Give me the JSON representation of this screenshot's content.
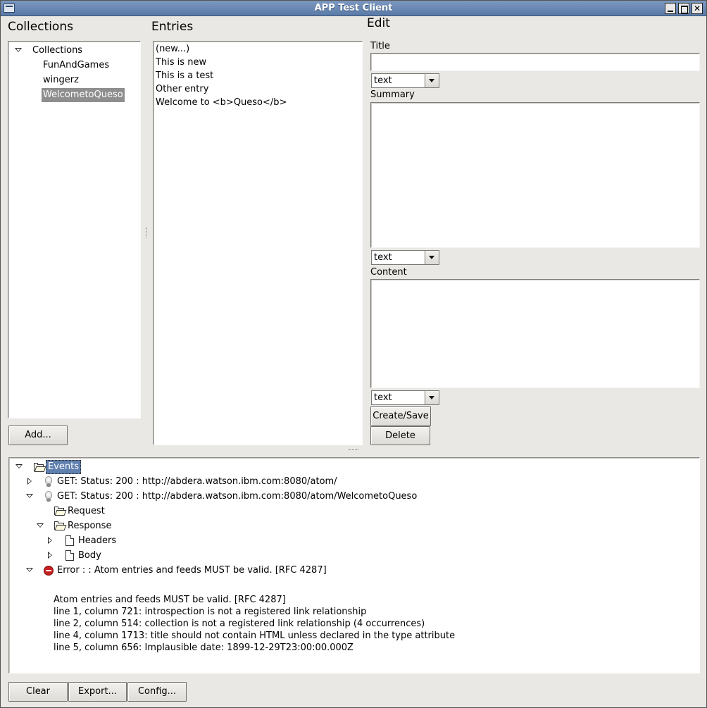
{
  "window": {
    "title": "APP Test Client"
  },
  "collections": {
    "header": "Collections",
    "root_label": "Collections",
    "items": [
      "FunAndGames",
      "wingerz",
      "WelcometoQueso"
    ],
    "add_button": "Add..."
  },
  "entries": {
    "header": "Entries",
    "items": [
      "(new...)",
      "This is new",
      "This is a test",
      "Other entry",
      "Welcome to <b>Queso</b>"
    ]
  },
  "edit": {
    "header": "Edit",
    "title_label": "Title",
    "title_value": "",
    "title_type": "text",
    "summary_label": "Summary",
    "summary_value": "",
    "summary_type": "text",
    "content_label": "Content",
    "content_value": "",
    "content_type": "text",
    "create_save_button": "Create/Save",
    "delete_button": "Delete"
  },
  "events": {
    "root_label": "Events",
    "rows": [
      "GET: Status: 200 : http://abdera.watson.ibm.com:8080/atom/",
      "GET: Status: 200 : http://abdera.watson.ibm.com:8080/atom/WelcometoQueso",
      "Request",
      "Response",
      "Headers",
      "Body",
      "Error :  : Atom entries and feeds MUST be valid. [RFC 4287]"
    ],
    "details": [
      "Atom entries and feeds MUST be valid. [RFC 4287]",
      "line 1, column 721: introspection is not a registered link relationship",
      "line 2, column 514: collection is not a registered link relationship (4 occurrences)",
      "line 4, column 1713: title should not contain HTML unless declared in the type attribute",
      "line 5, column 656: Implausible date: 1899-12-29T23:00:00.000Z"
    ]
  },
  "bottom_buttons": {
    "clear": "Clear",
    "export": "Export...",
    "config": "Config..."
  },
  "colors": {
    "titlebar": "#6a88b3",
    "selection": "#8e8e8e",
    "events_selection": "#5f7fae",
    "window_bg": "#e9e8e4"
  }
}
